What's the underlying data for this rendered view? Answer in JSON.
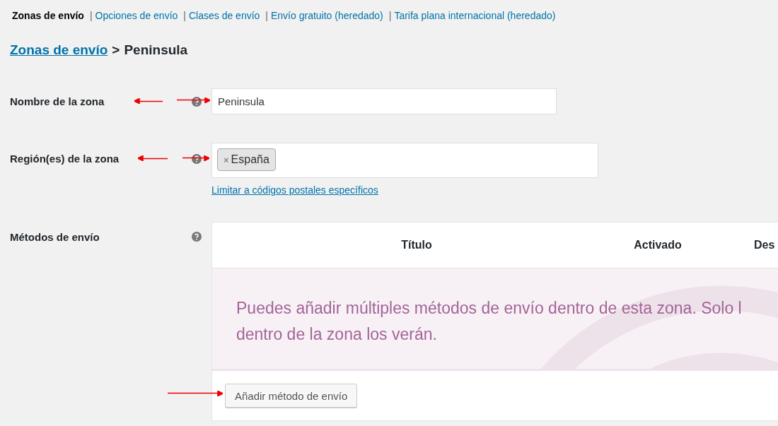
{
  "subnav": [
    {
      "label": "Zonas de envío",
      "selected": true
    },
    {
      "label": "Opciones de envío",
      "selected": false,
      "separator": "|"
    },
    {
      "label": "Clases de envío",
      "selected": false,
      "separator": "|"
    },
    {
      "label": "Envío gratuito (heredado)",
      "selected": false,
      "separator": "|"
    },
    {
      "label": "Tarifa plana internacional (heredado)",
      "selected": false,
      "separator": "|"
    }
  ],
  "breadcrumb": {
    "link": "Zonas de envío",
    "separator": ">",
    "current": "Peninsula"
  },
  "fields": [
    {
      "kind": "text",
      "label": "Nombre de la zona",
      "value": "Peninsula"
    },
    {
      "kind": "regions",
      "label": "Región(es) de la zona",
      "tags": [
        {
          "remove": "×",
          "label": "España"
        }
      ],
      "link": "Limitar a códigos postales específicos"
    },
    {
      "kind": "methods",
      "label": "Métodos de envío",
      "columns": [
        "Título",
        "Activado",
        "Des"
      ],
      "empty_message": [
        "Puedes añadir múltiples métodos de envío dentro de esta zona. Solo l",
        "dentro de la zona los verán."
      ],
      "button": "Añadir método de envío"
    }
  ]
}
